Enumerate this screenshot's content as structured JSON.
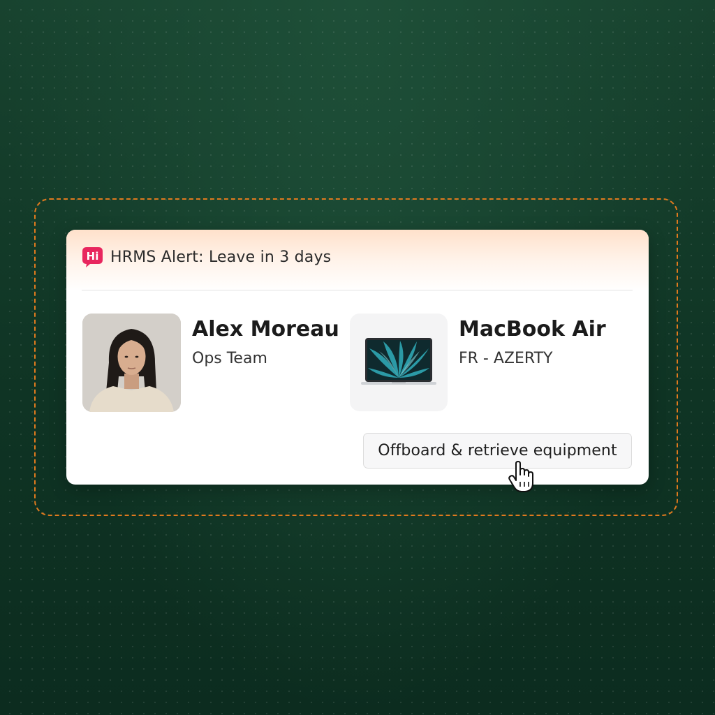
{
  "alert": {
    "logo_text": "Hi",
    "title": "HRMS Alert: Leave in 3 days"
  },
  "employee": {
    "name": "Alex Moreau",
    "team": "Ops Team",
    "avatar_icon": "person-portrait"
  },
  "device": {
    "name": "MacBook Air",
    "layout": "FR - AZERTY",
    "image_icon": "laptop-icon"
  },
  "action": {
    "label": "Offboard & retrieve equipment"
  },
  "colors": {
    "background": "#103a28",
    "dashed_frame": "#e07a1e",
    "logo": "#e8265e",
    "header_tint": "#ffe1cb",
    "card": "#ffffff"
  }
}
